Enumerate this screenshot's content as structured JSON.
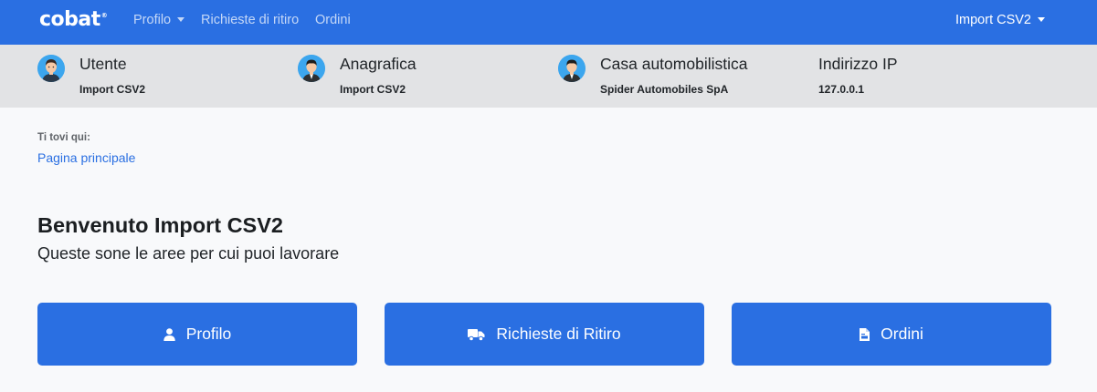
{
  "navbar": {
    "logo": "cobat",
    "logo_mark": "®",
    "links": [
      {
        "label": "Profilo",
        "has_dropdown": true
      },
      {
        "label": "Richieste di ritiro",
        "has_dropdown": false
      },
      {
        "label": "Ordini",
        "has_dropdown": false
      }
    ],
    "user_menu": "Import CSV2"
  },
  "infobar": {
    "items": [
      {
        "label": "Utente",
        "value": "Import CSV2",
        "icon": "user-avatar-icon"
      },
      {
        "label": "Anagrafica",
        "value": "Import CSV2",
        "icon": "businessman-avatar-icon"
      },
      {
        "label": "Casa automobilistica",
        "value": "Spider Automobiles SpA",
        "icon": "businessman-avatar-icon"
      },
      {
        "label": "Indirizzo IP",
        "value": "127.0.0.1"
      }
    ]
  },
  "breadcrumb": {
    "label": "Ti tovi qui:",
    "current": "Pagina principale"
  },
  "main": {
    "title": "Benvenuto Import CSV2",
    "subtitle": "Queste sone le aree per cui puoi lavorare",
    "cards": [
      {
        "label": "Profilo",
        "icon": "user-icon"
      },
      {
        "label": "Richieste di Ritiro",
        "icon": "truck-icon"
      },
      {
        "label": "Ordini",
        "icon": "file-invoice-icon"
      }
    ]
  },
  "colors": {
    "primary": "#2a6fe2",
    "infobar_bg": "#e2e3e5",
    "page_bg": "#f8f9fb",
    "avatar_bg": "#3ca6ee"
  }
}
